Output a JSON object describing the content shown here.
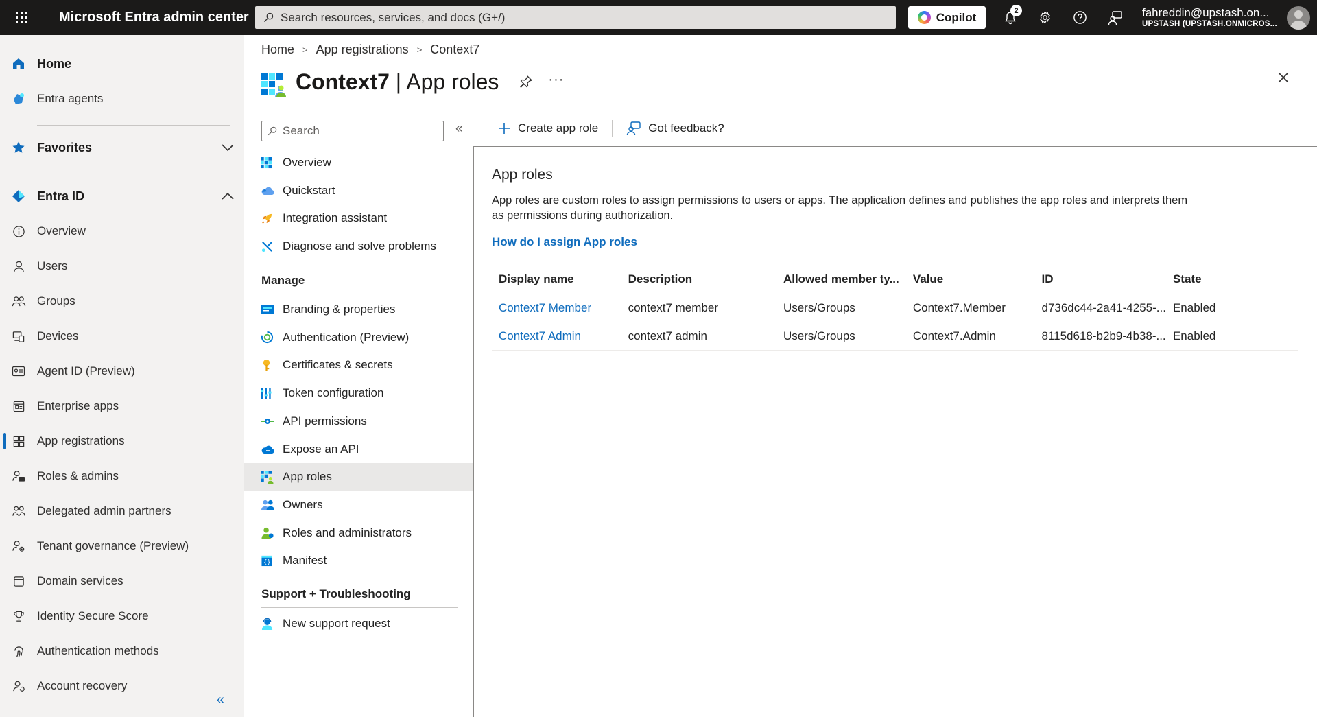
{
  "topbar": {
    "app_title": "Microsoft Entra admin center",
    "search_placeholder": "Search resources, services, and docs (G+/)",
    "copilot_label": "Copilot",
    "notification_count": "2",
    "account_email": "fahreddin@upstash.on...",
    "account_tenant": "UPSTASH (UPSTASH.ONMICROS..."
  },
  "leftnav": {
    "home": "Home",
    "entra_agents": "Entra agents",
    "favorites": "Favorites",
    "entra_id": "Entra ID",
    "items": [
      {
        "label": "Overview",
        "icon": "info-icon"
      },
      {
        "label": "Users",
        "icon": "user-icon"
      },
      {
        "label": "Groups",
        "icon": "groups-icon"
      },
      {
        "label": "Devices",
        "icon": "devices-icon"
      },
      {
        "label": "Agent ID (Preview)",
        "icon": "id-card-icon"
      },
      {
        "label": "Enterprise apps",
        "icon": "enterprise-apps-icon"
      },
      {
        "label": "App registrations",
        "icon": "app-registrations-icon"
      },
      {
        "label": "Roles & admins",
        "icon": "roles-icon"
      },
      {
        "label": "Delegated admin partners",
        "icon": "partners-icon"
      },
      {
        "label": "Tenant governance (Preview)",
        "icon": "governance-icon"
      },
      {
        "label": "Domain services",
        "icon": "domain-icon"
      },
      {
        "label": "Identity Secure Score",
        "icon": "trophy-icon"
      },
      {
        "label": "Authentication methods",
        "icon": "fingerprint-icon"
      },
      {
        "label": "Account recovery",
        "icon": "recovery-icon"
      }
    ],
    "active_item": "App registrations"
  },
  "breadcrumb": [
    "Home",
    "App registrations",
    "Context7"
  ],
  "page": {
    "title_app": "Context7",
    "title_sep": " | ",
    "title_blade": "App roles"
  },
  "resource_menu": {
    "search_placeholder": "Search",
    "top_items": [
      {
        "label": "Overview",
        "icon": "overview-grid-icon"
      },
      {
        "label": "Quickstart",
        "icon": "quickstart-cloud-icon"
      },
      {
        "label": "Integration assistant",
        "icon": "rocket-icon"
      },
      {
        "label": "Diagnose and solve problems",
        "icon": "wrench-icon"
      }
    ],
    "manage_header": "Manage",
    "manage_items": [
      {
        "label": "Branding & properties",
        "icon": "branding-icon"
      },
      {
        "label": "Authentication (Preview)",
        "icon": "authentication-icon"
      },
      {
        "label": "Certificates & secrets",
        "icon": "key-icon"
      },
      {
        "label": "Token configuration",
        "icon": "token-bars-icon"
      },
      {
        "label": "API permissions",
        "icon": "api-permissions-icon"
      },
      {
        "label": "Expose an API",
        "icon": "cloud-api-icon"
      },
      {
        "label": "App roles",
        "icon": "app-roles-icon"
      },
      {
        "label": "Owners",
        "icon": "owners-icon"
      },
      {
        "label": "Roles and administrators",
        "icon": "roles-admins-icon"
      },
      {
        "label": "Manifest",
        "icon": "manifest-icon"
      }
    ],
    "selected": "App roles",
    "support_header": "Support + Troubleshooting",
    "support_items": [
      {
        "label": "New support request",
        "icon": "support-person-icon"
      }
    ]
  },
  "commands": {
    "create_label": "Create app role",
    "feedback_label": "Got feedback?"
  },
  "content": {
    "section_title": "App roles",
    "description": "App roles are custom roles to assign permissions to users or apps. The application defines and publishes the app roles and interprets them as permissions during authorization.",
    "help_link": "How do I assign App roles",
    "table": {
      "columns": [
        "Display name",
        "Description",
        "Allowed member ty...",
        "Value",
        "ID",
        "State"
      ],
      "rows": [
        [
          "Context7 Member",
          "context7 member",
          "Users/Groups",
          "Context7.Member",
          "d736dc44-2a41-4255-...",
          "Enabled"
        ],
        [
          "Context7 Admin",
          "context7 admin",
          "Users/Groups",
          "Context7.Admin",
          "8115d618-b2b9-4b38-...",
          "Enabled"
        ]
      ]
    }
  },
  "colors": {
    "topbar_bg": "#1b1a19",
    "nav_bg": "#f3f2f1",
    "accent": "#0f6cbd",
    "selected_menu_bg": "#e9e8e7"
  }
}
